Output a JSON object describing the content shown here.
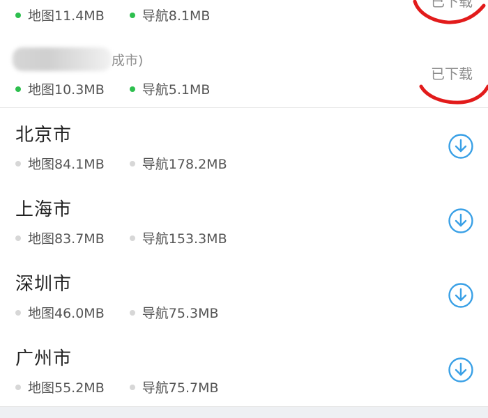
{
  "regions": [
    {
      "name": "",
      "map_size": "地图11.4MB",
      "nav_size": "导航8.1MB",
      "status": "已下载",
      "downloaded": true
    },
    {
      "name_visible_fragment": "成市)",
      "map_size": "地图10.3MB",
      "nav_size": "导航5.1MB",
      "status": "已下载",
      "downloaded": true
    },
    {
      "name": "北京市",
      "map_size": "地图84.1MB",
      "nav_size": "导航178.2MB",
      "downloaded": false
    },
    {
      "name": "上海市",
      "map_size": "地图83.7MB",
      "nav_size": "导航153.3MB",
      "downloaded": false
    },
    {
      "name": "深圳市",
      "map_size": "地图46.0MB",
      "nav_size": "导航75.3MB",
      "downloaded": false
    },
    {
      "name": "广州市",
      "map_size": "地图55.2MB",
      "nav_size": "导航75.7MB",
      "downloaded": false
    }
  ],
  "icons": {
    "download": "download-circle-icon",
    "downloaded_dot": "status-dot-green",
    "available_dot": "status-dot-gray"
  },
  "colors": {
    "downloaded_dot": "#2dbf4e",
    "available_dot": "#d7d7d7",
    "download_icon": "#39a0e6",
    "annotation": "#e21b1b",
    "status_text": "#8d8d8d",
    "footer_bg": "#eef0f3"
  }
}
